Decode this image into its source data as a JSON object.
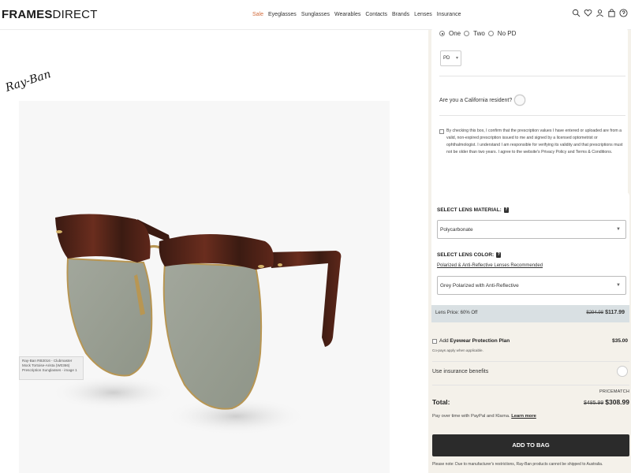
{
  "header": {
    "logo_bold": "FRAMES",
    "logo_light": "DIRECT",
    "nav": [
      "Sale",
      "Eyeglasses",
      "Sunglasses",
      "Wearables",
      "Contacts",
      "Brands",
      "Lenses",
      "Insurance"
    ],
    "icons": [
      "search-icon",
      "heart-icon",
      "account-icon",
      "bag-icon",
      "help-icon"
    ],
    "sale_color": "#d26a3a"
  },
  "product": {
    "brand_logo": "Ray-Ban",
    "image_caption": "Ray-Ban RB3016 - Clubmaster Mock Tortoise-Arista (W0366) Prescription Sunglasses - image 1"
  },
  "prescription": {
    "pd_options": [
      "One",
      "Two",
      "No PD"
    ],
    "pd_selected": "One",
    "pd_select_value": "PD",
    "california_question": "Are you a California resident?",
    "consent_text": "By checking this box, I confirm that the prescription values I have entered or uploaded are from a valid, non-expired prescription issued to me and signed by a licensed optometrist or ophthalmologist. I understand I am responsible for verifying its validity and that prescriptions must not be older than two years. I agree to the website's Privacy Policy and Terms & Conditions."
  },
  "lens": {
    "material_label": "SELECT LENS MATERIAL:",
    "material_value": "Polycarbonate",
    "color_label": "SELECT LENS COLOR:",
    "recommended_link": "Polarized & Anti-Reflective Lenses Recommended",
    "color_value": "Grey Polarized with Anti-Reflective",
    "price_label": "Lens Price: 60% Off",
    "price_original": "$294.98",
    "price_sale": "$117.99"
  },
  "protection": {
    "label_prefix": "Add",
    "label_bold": "Eyewear Protection Plan",
    "sub": "Co-pays apply when applicable.",
    "price": "$35.00"
  },
  "insurance_label": "Use insurance benefits",
  "summary": {
    "pricematch": "PRICEMATCH",
    "total_label": "Total:",
    "total_original": "$485.99",
    "total_sale": "$308.99",
    "paypal_text": "Pay over time with PayPal and Klarna.",
    "learn_more": "Learn more",
    "add_to_bag": "ADD TO BAG",
    "note": "Please note: Due to manufacturer's restrictions, Ray-Ban products cannot be shipped to Australia."
  },
  "colors": {
    "right_panel_bg": "#f4f1ea",
    "lens_price_bg": "#d9e0e3",
    "button_bg": "#2b2b2b"
  }
}
